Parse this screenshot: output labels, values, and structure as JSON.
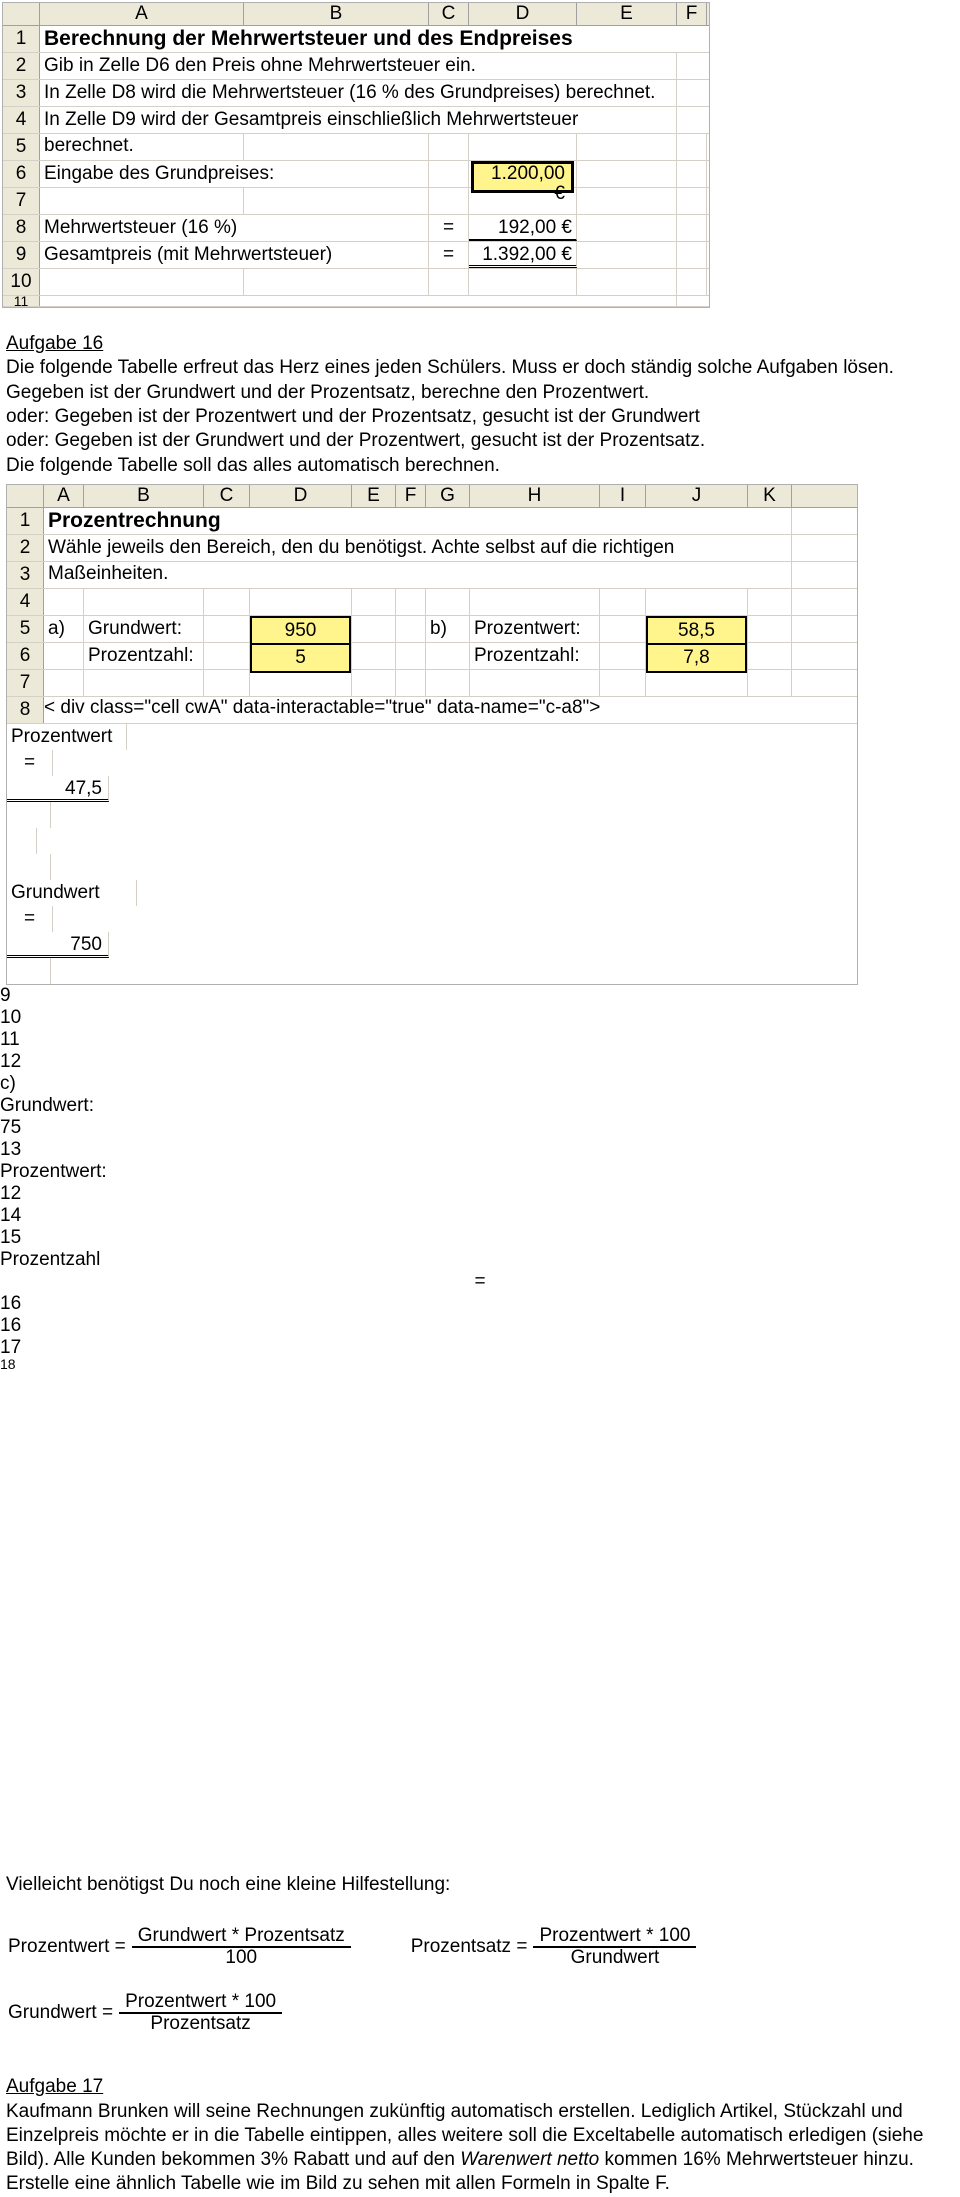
{
  "ex1": {
    "cols": {
      "A": "A",
      "B": "B",
      "C": "C",
      "D": "D",
      "E": "E",
      "F": "F"
    },
    "rows": {
      "r1": "1",
      "r2": "2",
      "r3": "3",
      "r4": "4",
      "r5": "5",
      "r6": "6",
      "r7": "7",
      "r8": "8",
      "r9": "9",
      "r10": "10",
      "r11": "11"
    },
    "title": "Berechnung der Mehrwertsteuer und des Endpreises",
    "l2": "Gib in Zelle D6 den Preis ohne Mehrwertsteuer ein.",
    "l3": "In Zelle D8 wird die Mehrwertsteuer (16 % des Grundpreises) berechnet.",
    "l4": "In Zelle D9 wird der Gesamtpreis einschließlich Mehrwertsteuer berechnet.",
    "l6": "Eingabe des Grundpreises:",
    "d6": "1.200,00 €",
    "l8": "Mehrwertsteuer (16 %)",
    "l9": "Gesamtpreis (mit Mehrwertsteuer)",
    "eq": "=",
    "d8": "192,00 €",
    "d9": "1.392,00 €"
  },
  "txt1": {
    "heading": "Aufgabe 16",
    "p1": "Die folgende Tabelle erfreut das Herz eines jeden Schülers. Muss er doch ständig solche Aufgaben lösen.",
    "p2": "Gegeben ist der Grundwert und der Prozentsatz, berechne den Prozentwert.",
    "p3": "oder: Gegeben ist der Prozentwert und der Prozentsatz, gesucht ist der Grundwert",
    "p4": "oder: Gegeben ist der Grundwert und der Prozentwert, gesucht ist der Prozentsatz.",
    "p5": "Die folgende Tabelle soll das alles automatisch berechnen."
  },
  "ex2": {
    "cols": {
      "A": "A",
      "B": "B",
      "C": "C",
      "D": "D",
      "E": "E",
      "F": "F",
      "G": "G",
      "H": "H",
      "I": "I",
      "J": "J",
      "K": "K"
    },
    "rows": {
      "r1": "1",
      "r2": "2",
      "r3": "3",
      "r4": "4",
      "r5": "5",
      "r6": "6",
      "r7": "7",
      "r8": "8",
      "r9": "9",
      "r10": "10",
      "r11": "11",
      "r12": "12",
      "r13": "13",
      "r14": "14",
      "r15": "15",
      "r16": "16",
      "r17": "17",
      "r18": "18"
    },
    "title": "Prozentrechnung",
    "subtitle": "Wähle jeweils den Bereich, den du benötigst. Achte selbst auf die richtigen Maßeinheiten.",
    "a_label": "a)",
    "b_label": "b)",
    "c_label": "c)",
    "grundwert": "Grundwert:",
    "prozentzahl": "Prozentzahl:",
    "prozentwert": "Prozentwert:",
    "grundwert_lbl": "Grundwert",
    "prozentwert_lbl": "Prozentwert",
    "prozentzahl_lbl": "Prozentzahl",
    "eq": "=",
    "a_gw": "950",
    "a_pz": "5",
    "a_pw": "47,5",
    "b_pw": "58,5",
    "b_pz": "7,8",
    "b_gw": "750",
    "c_gw": "75",
    "c_pw": "12",
    "c_pz": "16"
  },
  "hint": "Vielleicht benötigst Du noch eine kleine Hilfestellung:",
  "formulas": {
    "f1_lhs": "Prozentwert =",
    "f1_num": "Grundwert * Prozentsatz",
    "f1_den": "100",
    "f2_lhs": "Prozentsatz =",
    "f2_num": "Prozentwert * 100",
    "f2_den": "Grundwert",
    "f3_lhs": "Grundwert =",
    "f3_num": "Prozentwert * 100",
    "f3_den": "Prozentsatz"
  },
  "txt2": {
    "heading": "Aufgabe 17",
    "p_a": "Kaufmann Brunken will seine Rechnungen zukünftig automatisch erstellen. Lediglich Artikel, Stückzahl und Einzelpreis möchte er in die Tabelle eintippen, alles weitere soll die Exceltabelle automatisch erledigen (siehe Bild). Alle Kunden bekommen 3% Rabatt und auf den ",
    "p_b": "Warenwert netto",
    "p_c": " kommen 16% Mehrwertsteuer hinzu. Erstelle eine ähnlich Tabelle wie im Bild zu sehen mit allen Formeln in Spalte F."
  }
}
